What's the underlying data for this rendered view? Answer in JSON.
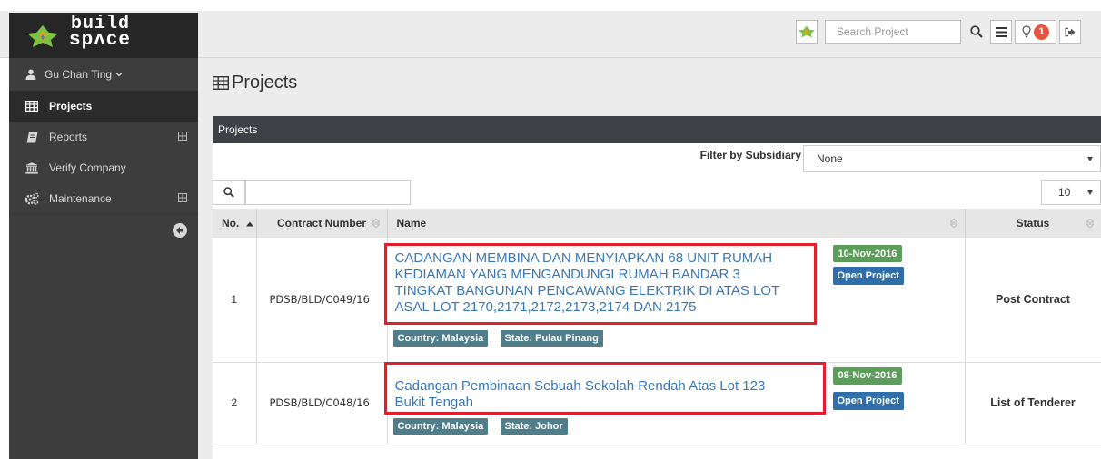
{
  "app": {
    "logo_line1": "build",
    "logo_line2": "spʌce"
  },
  "topbar": {
    "search_placeholder": "Search Project",
    "notification_count": "1"
  },
  "sidebar": {
    "user_name": "Gu Chan Ting",
    "items": [
      {
        "label": "Projects",
        "icon": "table-icon",
        "active": true
      },
      {
        "label": "Reports",
        "icon": "book-icon",
        "expandable": true
      },
      {
        "label": "Verify Company",
        "icon": "bank-icon"
      },
      {
        "label": "Maintenance",
        "icon": "cogs-icon",
        "expandable": true
      }
    ]
  },
  "page": {
    "title": "Projects"
  },
  "panel": {
    "heading": "Projects",
    "filter_label": "Filter by Subsidiary",
    "filter_value": "None",
    "page_size": "10",
    "columns": [
      "No.",
      "Contract Number",
      "Name",
      "Status"
    ],
    "rows": [
      {
        "no": "1",
        "contract": "PDSB/BLD/C049/16",
        "name_lines": [
          "CADANGAN MEMBINA DAN MENYIAPKAN 68 UNIT RUMAH",
          "KEDIAMAN YANG MENGANDUNGI RUMAH BANDAR 3",
          "TINGKAT BANGUNAN PENCAWANG ELEKTRIK DI ATAS LOT",
          "ASAL LOT 2170,2171,2172,2173,2174 DAN 2175"
        ],
        "date": "10-Nov-2016",
        "open_label": "Open Project",
        "country": "Country: Malaysia",
        "state": "State: Pulau Pinang",
        "status": "Post Contract"
      },
      {
        "no": "2",
        "contract": "PDSB/BLD/C048/16",
        "name_lines": [
          "Cadangan Pembinaan Sebuah Sekolah Rendah Atas Lot 123",
          "Bukit Tengah"
        ],
        "date": "08-Nov-2016",
        "open_label": "Open Project",
        "country": "Country: Malaysia",
        "state": "State: Johor",
        "status": "List of Tenderer"
      }
    ]
  },
  "colors": {
    "sidebar_bg": "#3d3d3d",
    "panel_header": "#3d4145",
    "link": "#3a78b5",
    "date_badge": "#5a9e5a",
    "open_button": "#2f6ea8",
    "tag": "#4f7d8a",
    "highlight": "#e0212b",
    "notification": "#e8553f"
  }
}
